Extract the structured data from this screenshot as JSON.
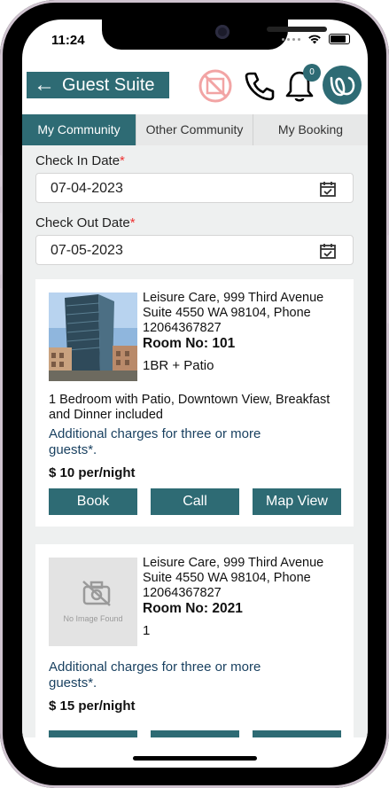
{
  "status": {
    "time": "11:24"
  },
  "header": {
    "title": "Guest Suite",
    "back_arrow": "←",
    "notification_count": "0",
    "icons": [
      "no-image-icon",
      "phone-icon",
      "bell-icon",
      "logo-icon"
    ]
  },
  "tabs": [
    {
      "label": "My Community",
      "active": true
    },
    {
      "label": "Other Community",
      "active": false
    },
    {
      "label": "My Booking",
      "active": false
    }
  ],
  "form": {
    "check_in_label": "Check In Date",
    "check_in_value": "07-04-2023",
    "check_out_label": "Check Out Date",
    "check_out_value": "07-05-2023",
    "required_mark": "*"
  },
  "rooms": [
    {
      "address": "Leisure Care, 999 Third Avenue Suite 4550 WA 98104, Phone 12064367827",
      "room_no": "Room No: 101",
      "type": "1BR + Patio",
      "description": "1 Bedroom with Patio, Downtown View, Breakfast and Dinner included",
      "extra": "Additional charges for three or more guests*.",
      "price": "$ 10 per/night",
      "buttons": {
        "book": "Book",
        "call": "Call",
        "map": "Map View"
      }
    },
    {
      "address": "Leisure Care, 999 Third Avenue Suite 4550 WA 98104, Phone 12064367827",
      "room_no": "Room No: 2021",
      "type": "1",
      "no_image_text": "No Image Found",
      "extra": "Additional charges for three or more guests*.",
      "price": "$ 15 per/night"
    }
  ],
  "colors": {
    "accent": "#2e6b74",
    "link_text": "#173f5f",
    "required": "#e33333"
  }
}
